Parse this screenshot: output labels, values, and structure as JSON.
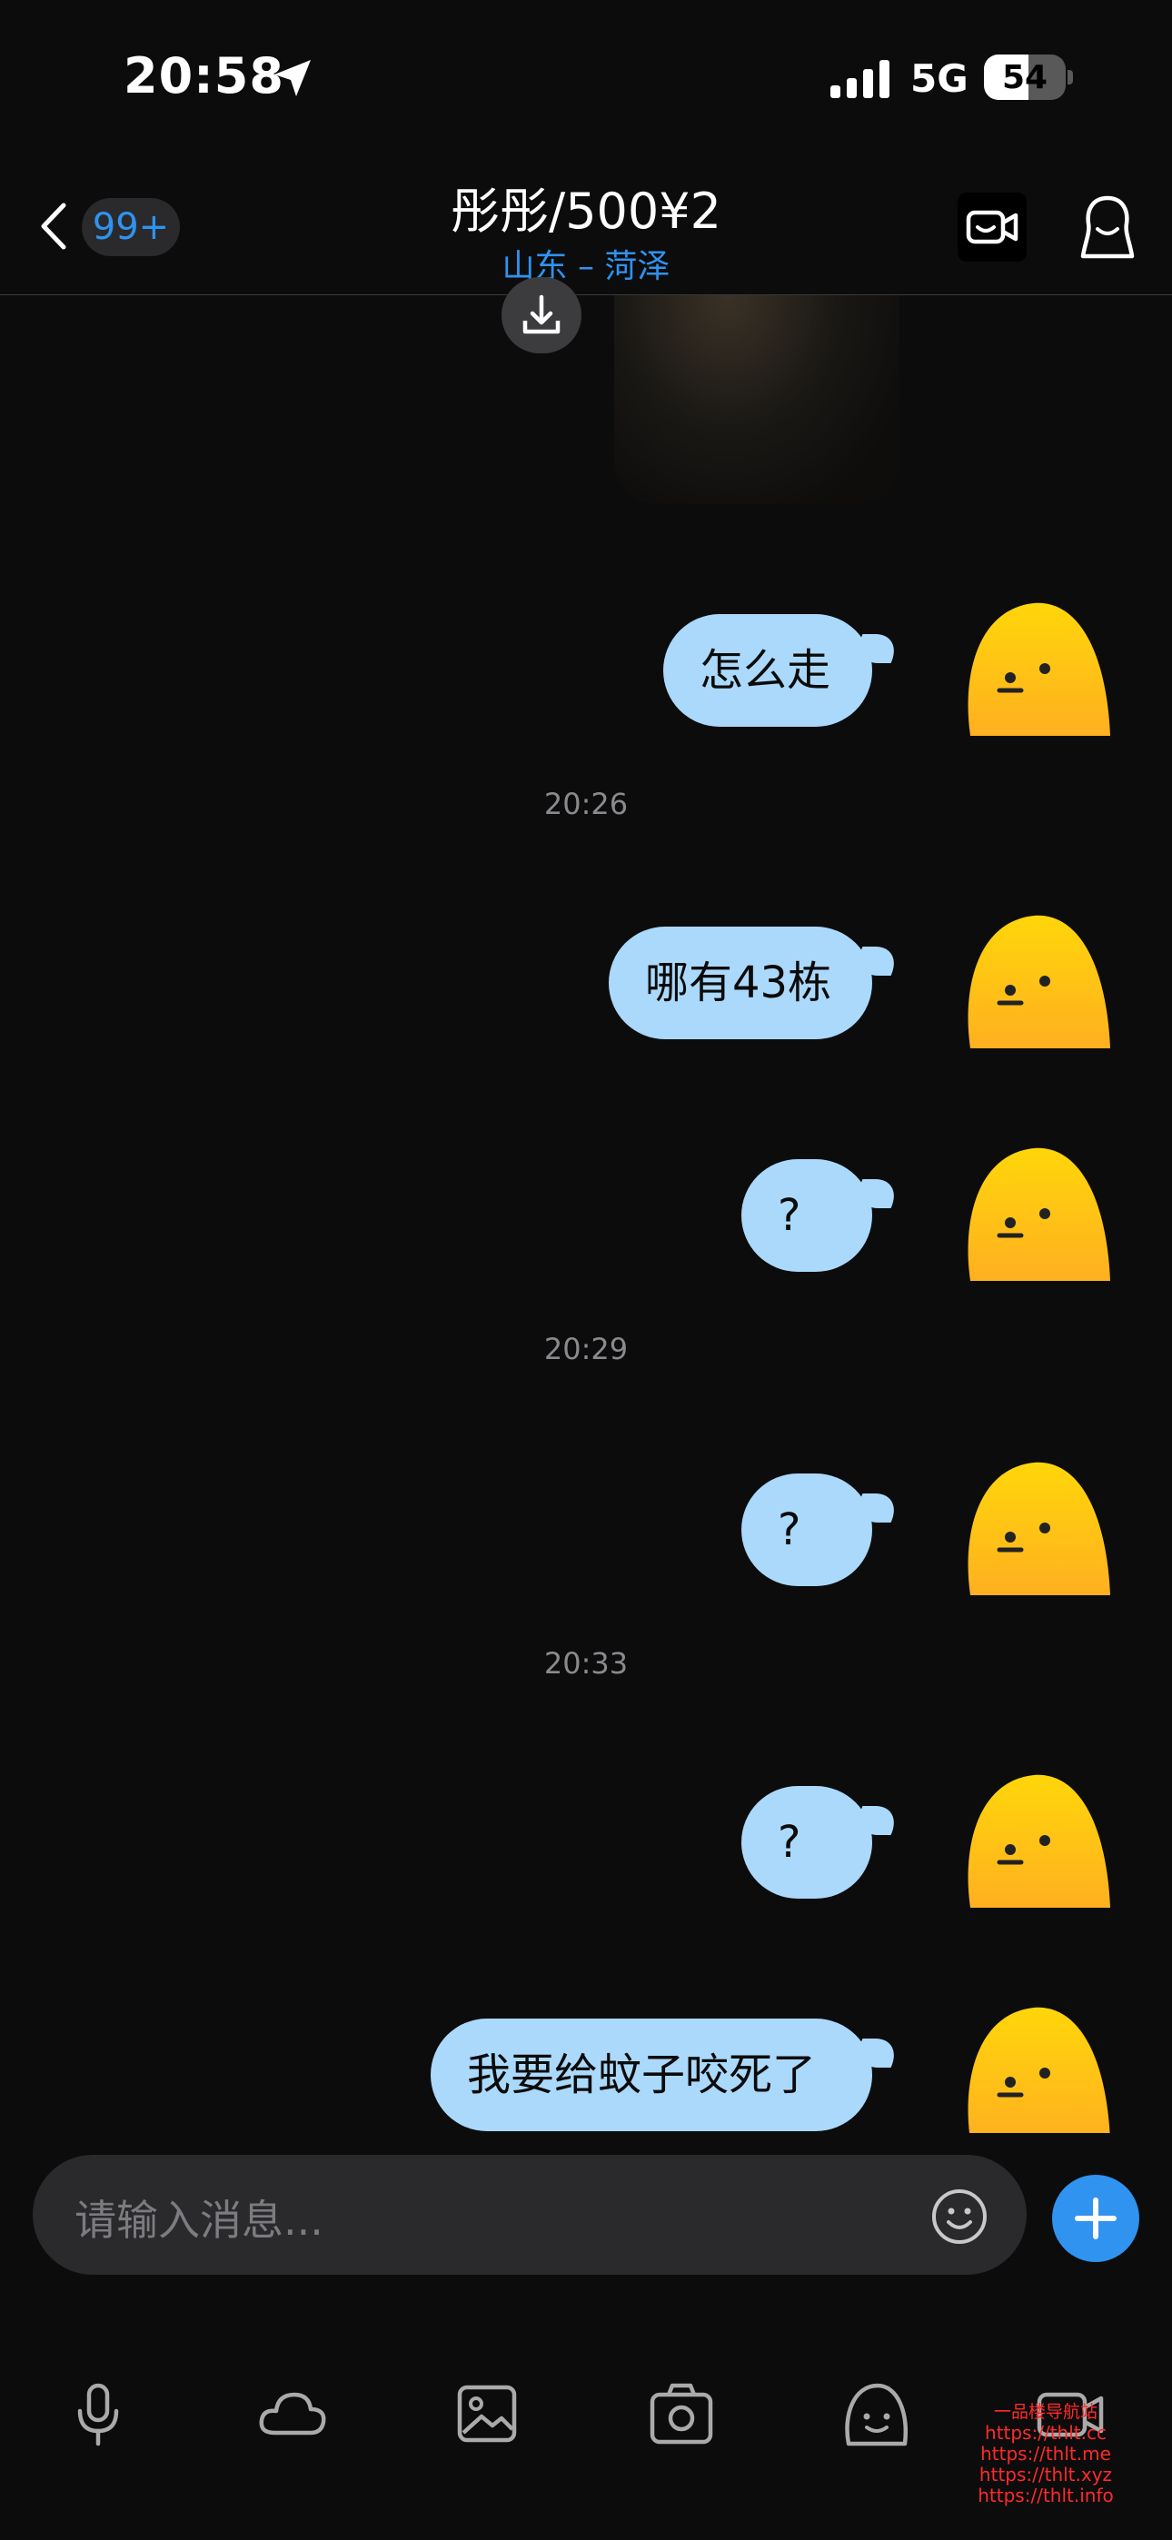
{
  "status_bar": {
    "time": "20:58",
    "network": "5G",
    "battery": "54",
    "battery_level": 0.54
  },
  "header": {
    "badge": "99+",
    "title": "彤彤/500¥2",
    "subtitle": "山东 – 菏泽"
  },
  "messages": [
    {
      "text": "怎么走"
    },
    {
      "timestamp": "20:26"
    },
    {
      "text": "哪有43栋"
    },
    {
      "text": "?"
    },
    {
      "timestamp": "20:29"
    },
    {
      "text": "?"
    },
    {
      "timestamp": "20:33"
    },
    {
      "text": "?"
    },
    {
      "text": "我要给蚊子咬死了"
    }
  ],
  "input": {
    "placeholder": "请输入消息..."
  },
  "toolbar": [
    "mic-icon",
    "cloud-icon",
    "image-icon",
    "camera-icon",
    "sticker-icon",
    "video-icon"
  ],
  "watermark": {
    "brand": "一品楼导航站",
    "urls": [
      "https://thlt.cc",
      "https://thlt.me",
      "https://thlt.xyz",
      "https://thlt.info"
    ]
  },
  "colors": {
    "accent": "#2f93ef",
    "bubble": "#abd9fb",
    "avatar": "#ffcc12"
  }
}
